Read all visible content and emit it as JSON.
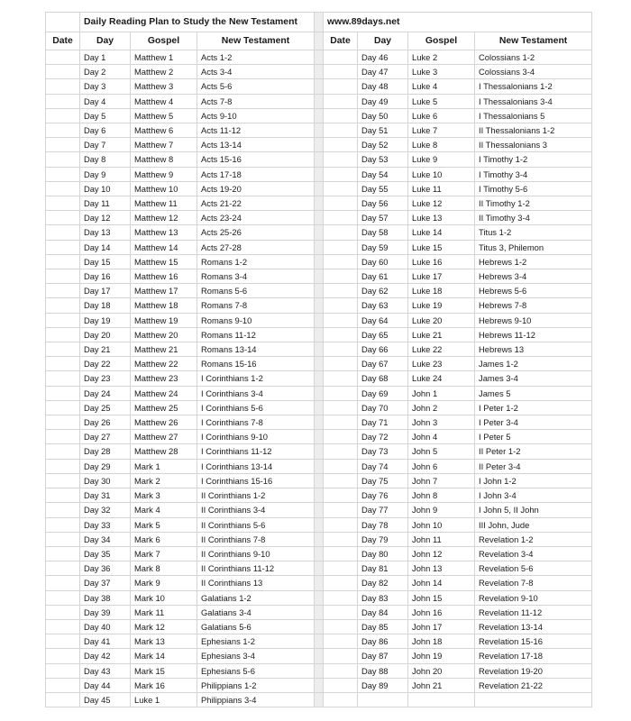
{
  "document": {
    "title": "Daily Reading Plan to Study the New Testament",
    "website": "www.89days.net"
  },
  "table": {
    "columns": [
      "Date",
      "Day",
      "Gospel",
      "New Testament"
    ],
    "left_column_headers": {
      "date": "Date",
      "day": "Day",
      "gospel": "Gospel",
      "new_testament": "New Testament"
    },
    "right_column_headers": {
      "date": "Date",
      "day": "Day",
      "gospel": "Gospel",
      "new_testament": "New Testament"
    },
    "left_rows": [
      {
        "date": "",
        "day": "Day 1",
        "gospel": "Matthew 1",
        "nt": "Acts 1-2"
      },
      {
        "date": "",
        "day": "Day 2",
        "gospel": "Matthew 2",
        "nt": "Acts 3-4"
      },
      {
        "date": "",
        "day": "Day 3",
        "gospel": "Matthew 3",
        "nt": "Acts 5-6"
      },
      {
        "date": "",
        "day": "Day 4",
        "gospel": "Matthew 4",
        "nt": "Acts 7-8"
      },
      {
        "date": "",
        "day": "Day 5",
        "gospel": "Matthew 5",
        "nt": "Acts 9-10"
      },
      {
        "date": "",
        "day": "Day 6",
        "gospel": "Matthew 6",
        "nt": "Acts 11-12"
      },
      {
        "date": "",
        "day": "Day 7",
        "gospel": "Matthew 7",
        "nt": "Acts 13-14"
      },
      {
        "date": "",
        "day": "Day 8",
        "gospel": "Matthew 8",
        "nt": "Acts 15-16"
      },
      {
        "date": "",
        "day": "Day 9",
        "gospel": "Matthew 9",
        "nt": "Acts 17-18"
      },
      {
        "date": "",
        "day": "Day 10",
        "gospel": "Matthew 10",
        "nt": "Acts 19-20"
      },
      {
        "date": "",
        "day": "Day 11",
        "gospel": "Matthew 11",
        "nt": "Acts 21-22"
      },
      {
        "date": "",
        "day": "Day 12",
        "gospel": "Matthew 12",
        "nt": "Acts 23-24"
      },
      {
        "date": "",
        "day": "Day 13",
        "gospel": "Matthew 13",
        "nt": "Acts 25-26"
      },
      {
        "date": "",
        "day": "Day 14",
        "gospel": "Matthew 14",
        "nt": "Acts 27-28"
      },
      {
        "date": "",
        "day": "Day 15",
        "gospel": "Matthew 15",
        "nt": "Romans 1-2"
      },
      {
        "date": "",
        "day": "Day 16",
        "gospel": "Matthew 16",
        "nt": "Romans 3-4"
      },
      {
        "date": "",
        "day": "Day 17",
        "gospel": "Matthew 17",
        "nt": "Romans 5-6"
      },
      {
        "date": "",
        "day": "Day 18",
        "gospel": "Matthew 18",
        "nt": "Romans 7-8"
      },
      {
        "date": "",
        "day": "Day 19",
        "gospel": "Matthew 19",
        "nt": "Romans 9-10"
      },
      {
        "date": "",
        "day": "Day 20",
        "gospel": "Matthew 20",
        "nt": "Romans 11-12"
      },
      {
        "date": "",
        "day": "Day 21",
        "gospel": "Matthew 21",
        "nt": "Romans 13-14"
      },
      {
        "date": "",
        "day": "Day 22",
        "gospel": "Matthew 22",
        "nt": "Romans 15-16"
      },
      {
        "date": "",
        "day": "Day 23",
        "gospel": "Matthew 23",
        "nt": "I Corinthians 1-2"
      },
      {
        "date": "",
        "day": "Day 24",
        "gospel": "Matthew 24",
        "nt": "I Corinthians 3-4"
      },
      {
        "date": "",
        "day": "Day 25",
        "gospel": "Matthew 25",
        "nt": "I Corinthians 5-6"
      },
      {
        "date": "",
        "day": "Day 26",
        "gospel": "Matthew 26",
        "nt": "I Corinthians 7-8"
      },
      {
        "date": "",
        "day": "Day 27",
        "gospel": "Matthew 27",
        "nt": "I Corinthians 9-10"
      },
      {
        "date": "",
        "day": "Day 28",
        "gospel": "Matthew 28",
        "nt": "I Corinthians 11-12"
      },
      {
        "date": "",
        "day": "Day 29",
        "gospel": "Mark 1",
        "nt": "I Corinthians 13-14"
      },
      {
        "date": "",
        "day": "Day 30",
        "gospel": "Mark 2",
        "nt": "I Corinthians 15-16"
      },
      {
        "date": "",
        "day": "Day 31",
        "gospel": "Mark 3",
        "nt": "II Corinthians 1-2"
      },
      {
        "date": "",
        "day": "Day 32",
        "gospel": "Mark 4",
        "nt": "II Corinthians 3-4"
      },
      {
        "date": "",
        "day": "Day 33",
        "gospel": "Mark 5",
        "nt": "II Corinthians 5-6"
      },
      {
        "date": "",
        "day": "Day 34",
        "gospel": "Mark 6",
        "nt": "II Corinthians 7-8"
      },
      {
        "date": "",
        "day": "Day 35",
        "gospel": "Mark 7",
        "nt": "II Corinthians 9-10"
      },
      {
        "date": "",
        "day": "Day 36",
        "gospel": "Mark 8",
        "nt": "II Corinthians 11-12"
      },
      {
        "date": "",
        "day": "Day 37",
        "gospel": "Mark 9",
        "nt": "II Corinthians 13"
      },
      {
        "date": "",
        "day": "Day 38",
        "gospel": "Mark 10",
        "nt": "Galatians 1-2"
      },
      {
        "date": "",
        "day": "Day 39",
        "gospel": "Mark 11",
        "nt": "Galatians 3-4"
      },
      {
        "date": "",
        "day": "Day 40",
        "gospel": "Mark 12",
        "nt": "Galatians 5-6"
      },
      {
        "date": "",
        "day": "Day 41",
        "gospel": "Mark 13",
        "nt": "Ephesians 1-2"
      },
      {
        "date": "",
        "day": "Day 42",
        "gospel": "Mark 14",
        "nt": "Ephesians 3-4"
      },
      {
        "date": "",
        "day": "Day 43",
        "gospel": "Mark 15",
        "nt": "Ephesians 5-6"
      },
      {
        "date": "",
        "day": "Day 44",
        "gospel": "Mark 16",
        "nt": "Philippians 1-2"
      },
      {
        "date": "",
        "day": "Day 45",
        "gospel": "Luke 1",
        "nt": "Philippians 3-4"
      }
    ],
    "right_rows": [
      {
        "date": "",
        "day": "Day 46",
        "gospel": "Luke 2",
        "nt": "Colossians 1-2"
      },
      {
        "date": "",
        "day": "Day 47",
        "gospel": "Luke 3",
        "nt": "Colossians 3-4"
      },
      {
        "date": "",
        "day": "Day 48",
        "gospel": "Luke 4",
        "nt": "I Thessalonians 1-2"
      },
      {
        "date": "",
        "day": "Day 49",
        "gospel": "Luke 5",
        "nt": "I Thessalonians 3-4"
      },
      {
        "date": "",
        "day": "Day 50",
        "gospel": "Luke 6",
        "nt": "I Thessalonians 5"
      },
      {
        "date": "",
        "day": "Day 51",
        "gospel": "Luke 7",
        "nt": "II Thessalonians 1-2"
      },
      {
        "date": "",
        "day": "Day 52",
        "gospel": "Luke 8",
        "nt": "II Thessalonians 3"
      },
      {
        "date": "",
        "day": "Day 53",
        "gospel": "Luke 9",
        "nt": "I Timothy 1-2"
      },
      {
        "date": "",
        "day": "Day 54",
        "gospel": "Luke 10",
        "nt": "I Timothy 3-4"
      },
      {
        "date": "",
        "day": "Day 55",
        "gospel": "Luke 11",
        "nt": "I Timothy 5-6"
      },
      {
        "date": "",
        "day": "Day 56",
        "gospel": "Luke 12",
        "nt": "II Timothy 1-2"
      },
      {
        "date": "",
        "day": "Day 57",
        "gospel": "Luke 13",
        "nt": "II Timothy 3-4"
      },
      {
        "date": "",
        "day": "Day 58",
        "gospel": "Luke 14",
        "nt": "Titus 1-2"
      },
      {
        "date": "",
        "day": "Day 59",
        "gospel": "Luke 15",
        "nt": "Titus 3, Philemon"
      },
      {
        "date": "",
        "day": "Day 60",
        "gospel": "Luke 16",
        "nt": "Hebrews 1-2"
      },
      {
        "date": "",
        "day": "Day 61",
        "gospel": "Luke 17",
        "nt": "Hebrews 3-4"
      },
      {
        "date": "",
        "day": "Day 62",
        "gospel": "Luke 18",
        "nt": "Hebrews 5-6"
      },
      {
        "date": "",
        "day": "Day 63",
        "gospel": "Luke 19",
        "nt": "Hebrews 7-8"
      },
      {
        "date": "",
        "day": "Day 64",
        "gospel": "Luke 20",
        "nt": "Hebrews 9-10"
      },
      {
        "date": "",
        "day": "Day 65",
        "gospel": "Luke 21",
        "nt": "Hebrews 11-12"
      },
      {
        "date": "",
        "day": "Day 66",
        "gospel": "Luke 22",
        "nt": "Hebrews 13"
      },
      {
        "date": "",
        "day": "Day 67",
        "gospel": "Luke 23",
        "nt": "James 1-2"
      },
      {
        "date": "",
        "day": "Day 68",
        "gospel": "Luke 24",
        "nt": "James 3-4"
      },
      {
        "date": "",
        "day": "Day 69",
        "gospel": "John 1",
        "nt": "James 5"
      },
      {
        "date": "",
        "day": "Day 70",
        "gospel": "John 2",
        "nt": "I Peter 1-2"
      },
      {
        "date": "",
        "day": "Day 71",
        "gospel": "John 3",
        "nt": "I Peter 3-4"
      },
      {
        "date": "",
        "day": "Day 72",
        "gospel": "John 4",
        "nt": "I Peter 5"
      },
      {
        "date": "",
        "day": "Day 73",
        "gospel": "John 5",
        "nt": "II Peter 1-2"
      },
      {
        "date": "",
        "day": "Day 74",
        "gospel": "John 6",
        "nt": "II Peter 3-4"
      },
      {
        "date": "",
        "day": "Day 75",
        "gospel": "John 7",
        "nt": "I John 1-2"
      },
      {
        "date": "",
        "day": "Day 76",
        "gospel": "John 8",
        "nt": "I John 3-4"
      },
      {
        "date": "",
        "day": "Day 77",
        "gospel": "John 9",
        "nt": "I John 5, II John"
      },
      {
        "date": "",
        "day": "Day 78",
        "gospel": "John 10",
        "nt": "III John, Jude"
      },
      {
        "date": "",
        "day": "Day 79",
        "gospel": "John 11",
        "nt": "Revelation 1-2"
      },
      {
        "date": "",
        "day": "Day 80",
        "gospel": "John 12",
        "nt": "Revelation 3-4"
      },
      {
        "date": "",
        "day": "Day 81",
        "gospel": "John 13",
        "nt": "Revelation 5-6"
      },
      {
        "date": "",
        "day": "Day 82",
        "gospel": "John 14",
        "nt": "Revelation 7-8"
      },
      {
        "date": "",
        "day": "Day 83",
        "gospel": "John 15",
        "nt": "Revelation 9-10"
      },
      {
        "date": "",
        "day": "Day 84",
        "gospel": "John 16",
        "nt": "Revelation 11-12"
      },
      {
        "date": "",
        "day": "Day 85",
        "gospel": "John 17",
        "nt": "Revelation 13-14"
      },
      {
        "date": "",
        "day": "Day 86",
        "gospel": "John 18",
        "nt": "Revelation 15-16"
      },
      {
        "date": "",
        "day": "Day 87",
        "gospel": "John 19",
        "nt": "Revelation 17-18"
      },
      {
        "date": "",
        "day": "Day 88",
        "gospel": "John 20",
        "nt": "Revelation 19-20"
      },
      {
        "date": "",
        "day": "Day 89",
        "gospel": "John 21",
        "nt": "Revelation 21-22"
      },
      {
        "date": "",
        "day": "",
        "gospel": "",
        "nt": ""
      }
    ]
  },
  "colors": {
    "border": "#d4d4d4",
    "gutter": "#eceded",
    "text": "#1a1a1a",
    "background": "#ffffff"
  }
}
